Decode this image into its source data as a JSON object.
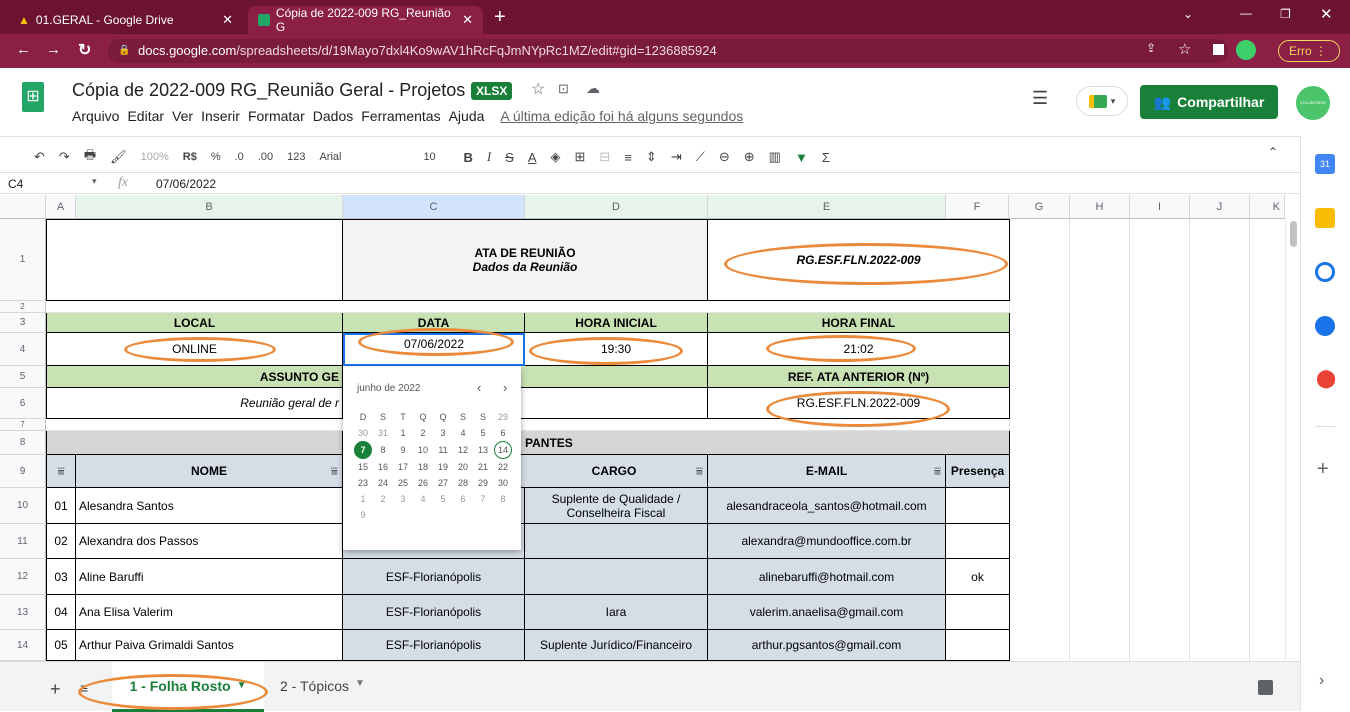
{
  "browser": {
    "tabs": [
      {
        "title": "01.GERAL - Google Drive"
      },
      {
        "title": "Cópia de 2022-009 RG_Reunião G"
      }
    ],
    "url_domain": "docs.google.com",
    "url_path": "/spreadsheets/d/19Mayo7dxl4Ko9wAV1hRcFqJmNYpRc1MZ/edit#gid=1236885924",
    "profile_label": "Erro"
  },
  "doc": {
    "title": "Cópia de 2022-009 RG_Reunião Geral - Projetos",
    "badge": "XLSX",
    "menus": [
      "Arquivo",
      "Editar",
      "Ver",
      "Inserir",
      "Formatar",
      "Dados",
      "Ferramentas",
      "Ajuda"
    ],
    "last_edit": "A última edição foi há alguns segundos",
    "share_label": "Compartilhar",
    "avatar_text": "VOLUNTÁRIO"
  },
  "toolbar": {
    "zoom": "100%",
    "currency": "R$",
    "percent": "%",
    "dec_less": ".0",
    "dec_more": ".00",
    "format": "123",
    "font": "Arial",
    "size": "10"
  },
  "formula": {
    "cell_ref": "C4",
    "fx": "fx",
    "value": "07/06/2022"
  },
  "columns": [
    "A",
    "B",
    "C",
    "D",
    "E",
    "F",
    "G",
    "H",
    "I",
    "J",
    "K"
  ],
  "rows": [
    "1",
    "2",
    "3",
    "4",
    "5",
    "6",
    "7",
    "8",
    "9",
    "10",
    "11",
    "12",
    "13",
    "14"
  ],
  "sheet": {
    "ata_title": "ATA DE REUNIÃO",
    "ata_sub": "Dados da Reunião",
    "ata_code": "RG.ESF.FLN.2022-009",
    "h_local": "LOCAL",
    "h_data": "DATA",
    "h_hora_ini": "HORA INICIAL",
    "h_hora_fim": "HORA FINAL",
    "local": "ONLINE",
    "data": "07/06/2022",
    "hora_ini": "19:30",
    "hora_fim": "21:02",
    "h_assunto": "ASSUNTO GE",
    "h_ref": "REF. ATA ANTERIOR (Nº)",
    "assunto": "Reunião geral de r",
    "ref": "RG.ESF.FLN.2022-009",
    "participantes": "PANTES",
    "h_nome": "NOME",
    "h_cargo": "CARGO",
    "h_email": "E-MAIL",
    "h_presenca": "Presença",
    "people": [
      {
        "num": "01",
        "nome": "Alesandra Santos",
        "org": "",
        "cargo": "Suplente de Qualidade / Conselheira Fiscal",
        "email": "alesandraceola_santos@hotmail.com",
        "presenca": ""
      },
      {
        "num": "02",
        "nome": "Alexandra dos Passos",
        "org": "",
        "cargo": "",
        "email": "alexandra@mundooffice.com.br",
        "presenca": ""
      },
      {
        "num": "03",
        "nome": "Aline Baruffi",
        "org": "ESF-Florianópolis",
        "cargo": "",
        "email": "alinebaruffi@hotmail.com",
        "presenca": "ok"
      },
      {
        "num": "04",
        "nome": "Ana Elisa Valerim",
        "org": "ESF-Florianópolis",
        "cargo": "Iara",
        "email": "valerim.anaelisa@gmail.com",
        "presenca": ""
      },
      {
        "num": "05",
        "nome": "Arthur Paiva Grimaldi Santos",
        "org": "ESF-Florianópolis",
        "cargo": "Suplente Jurídico/Financeiro",
        "email": "arthur.pgsantos@gmail.com",
        "presenca": ""
      }
    ]
  },
  "calendar": {
    "month": "junho de 2022",
    "weekdays": [
      "D",
      "S",
      "T",
      "Q",
      "Q",
      "S",
      "S"
    ],
    "weeks": [
      [
        "29",
        "30",
        "31",
        "1",
        "2",
        "3",
        "4"
      ],
      [
        "5",
        "6",
        "7",
        "8",
        "9",
        "10",
        "11"
      ],
      [
        "12",
        "13",
        "14",
        "15",
        "16",
        "17",
        "18"
      ],
      [
        "19",
        "20",
        "21",
        "22",
        "23",
        "24",
        "25"
      ],
      [
        "26",
        "27",
        "28",
        "29",
        "30",
        "1",
        "2"
      ],
      [
        "3",
        "4",
        "5",
        "6",
        "7",
        "8",
        "9"
      ]
    ],
    "selected": "7",
    "today": "14"
  },
  "sheets": [
    {
      "label": "1 - Folha Rosto"
    },
    {
      "label": "2 - Tópicos"
    }
  ],
  "colors": {
    "chrome": "#6b1330",
    "green_header": "#c9e2b3",
    "gray_header": "#d6d6d6",
    "blue_cell": "#d5dde7",
    "annotation": "#ea8a3a"
  }
}
